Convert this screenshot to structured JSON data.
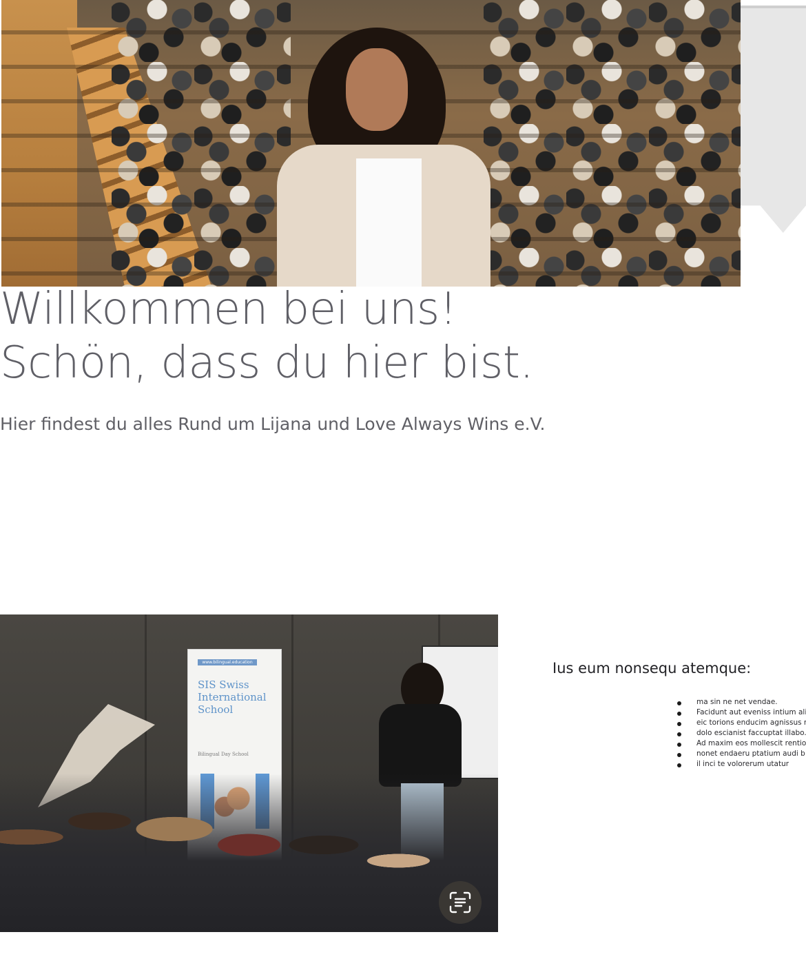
{
  "hero": {
    "headline_line1": "Willkommen bei uns!",
    "headline_line2": "Schön, dass du hier bist.",
    "subline": "Hier findest du alles Rund um Lijana und Love Always Wins e.V."
  },
  "event_banner": {
    "url": "www.bilingual.education",
    "title": "SIS Swiss International School",
    "subtitle": "Bilingual Day School"
  },
  "list_section": {
    "title": "Ius eum nonsequ atemque:",
    "items": [
      "ma sin ne net vendae.",
      "Facidunt aut eveniss intium ali",
      "eic torions enducim agnissus n",
      "dolo escianist faccuptat illabo.",
      "Ad maxim eos mollescit rentio",
      "nonet endaeru ptatium audi b",
      "il inci te volorerum utatur"
    ]
  },
  "icons": {
    "scan_button": "text-scan-icon"
  },
  "colors": {
    "headline": "#5f5f66",
    "subline": "#606066",
    "ribbon": "#e7e7e7"
  }
}
